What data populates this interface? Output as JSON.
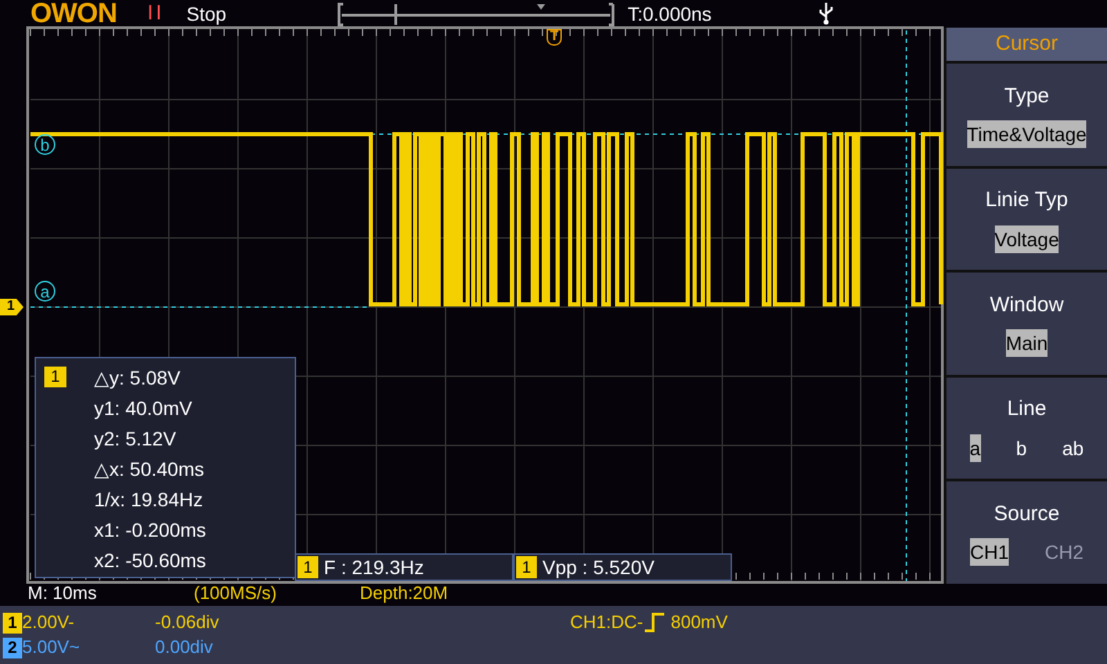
{
  "header": {
    "logo": "OWON",
    "run_state_icon": "II",
    "status": "Stop",
    "trigger_time": "T:0.000ns"
  },
  "trigger_marker": "T",
  "cursors": [
    {
      "label": "b"
    },
    {
      "label": "a"
    }
  ],
  "channel_marker": "1",
  "cursor_readout": {
    "channel": "1",
    "lines": [
      "△y: 5.08V",
      "y1: 40.0mV",
      "y2: 5.12V",
      "△x: 50.40ms",
      "1/x: 19.84Hz",
      "x1: -0.200ms",
      "x2: -50.60ms"
    ]
  },
  "measurements": [
    {
      "channel": "1",
      "text": "F : 219.3Hz"
    },
    {
      "channel": "1",
      "text": "Vpp : 5.520V"
    }
  ],
  "menu": {
    "title": "Cursor",
    "sections": [
      {
        "label": "Type",
        "options": [
          {
            "text": "Time&Voltage",
            "selected": true
          }
        ]
      },
      {
        "label": "Linie Typ",
        "options": [
          {
            "text": "Voltage",
            "selected": true
          }
        ]
      },
      {
        "label": "Window",
        "options": [
          {
            "text": "Main",
            "selected": true
          }
        ]
      },
      {
        "label": "Line",
        "options": [
          {
            "text": "a",
            "selected": true
          },
          {
            "text": "b",
            "selected": false
          },
          {
            "text": "ab",
            "selected": false
          }
        ]
      },
      {
        "label": "Source",
        "options": [
          {
            "text": "CH1",
            "selected": true
          },
          {
            "text": "CH2",
            "selected": false
          }
        ]
      }
    ]
  },
  "timebase": {
    "scale": "M: 10ms",
    "rate": "(100MS/s)",
    "depth": "Depth:20M"
  },
  "channels": [
    {
      "number": "1",
      "scale": "2.00V-",
      "offset": "-0.06div",
      "color": "#f5d000"
    },
    {
      "number": "2",
      "scale": "5.00V~",
      "offset": "0.00div",
      "color": "#4da6ff"
    }
  ],
  "trigger": {
    "source": "CH1:DC-",
    "level": "800mV"
  }
}
